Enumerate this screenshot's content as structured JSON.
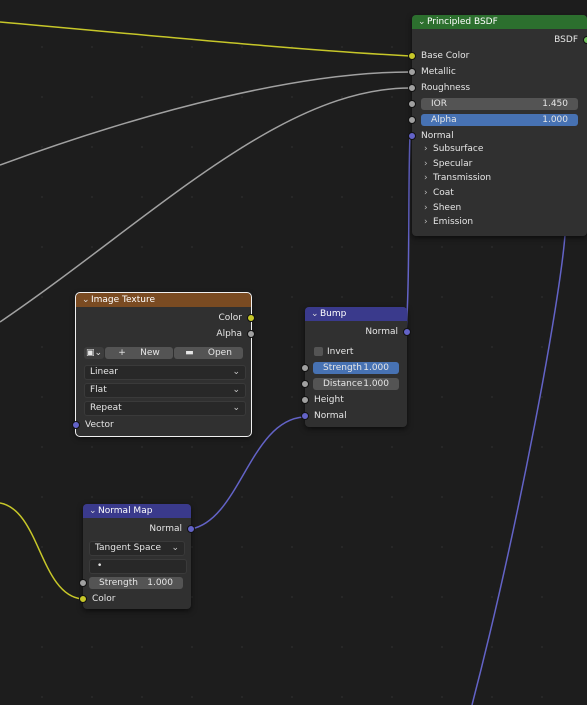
{
  "colors": {
    "shader_header": "#2c6f2e",
    "texture_header": "#7a4b22",
    "vector_header": "#3a3a8c",
    "float_socket": "#a1a1a1",
    "color_socket": "#c7c729",
    "vector_socket": "#6363c7",
    "field_active": "#4772b3"
  },
  "principled": {
    "title": "Principled BSDF",
    "out_bsdf": "BSDF",
    "base_color": "Base Color",
    "metallic": "Metallic",
    "roughness": "Roughness",
    "ior_label": "IOR",
    "ior_value": "1.450",
    "alpha_label": "Alpha",
    "alpha_value": "1.000",
    "normal": "Normal",
    "panels": [
      "Subsurface",
      "Specular",
      "Transmission",
      "Coat",
      "Sheen",
      "Emission"
    ]
  },
  "image_texture": {
    "title": "Image Texture",
    "out_color": "Color",
    "out_alpha": "Alpha",
    "new_label": "New",
    "open_label": "Open",
    "interpolation": "Linear",
    "projection": "Flat",
    "extension": "Repeat",
    "vector": "Vector"
  },
  "bump": {
    "title": "Bump",
    "out_normal": "Normal",
    "invert": "Invert",
    "strength_label": "Strength",
    "strength_value": "1.000",
    "distance_label": "Distance",
    "distance_value": "1.000",
    "height": "Height",
    "normal": "Normal"
  },
  "normal_map": {
    "title": "Normal Map",
    "out_normal": "Normal",
    "space": "Tangent Space",
    "uv_value": "•",
    "strength_label": "Strength",
    "strength_value": "1.000",
    "color": "Color"
  }
}
